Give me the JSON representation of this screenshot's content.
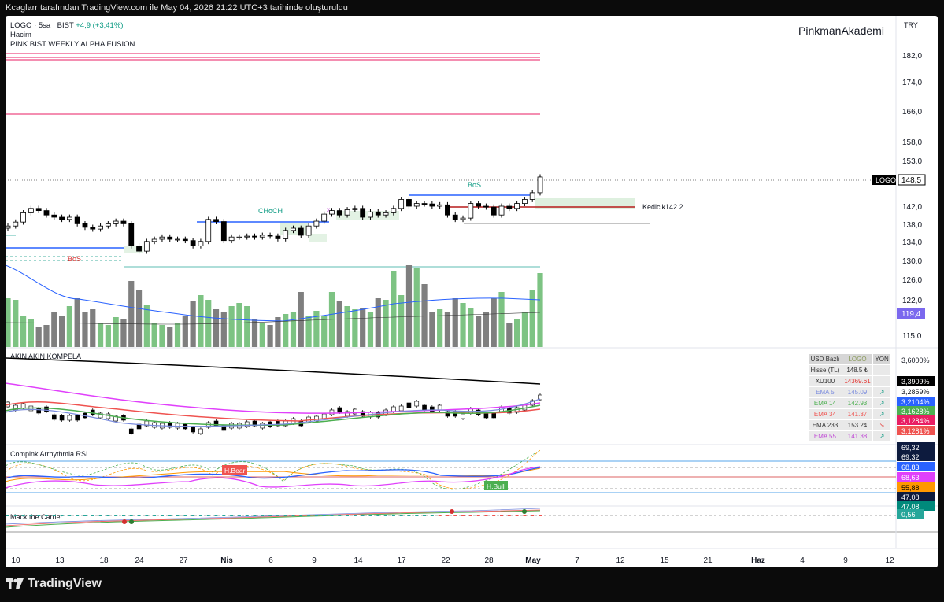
{
  "topbar": {
    "text": "Kcaglarr tarafından TradingView.com ile May 04, 2026 21:22 UTC+3 tarihinde oluşturuldu"
  },
  "legend": {
    "symbol": "LOGO · 5sa · BIST",
    "change": "+4,9 (+3,41%)",
    "volume": "Hacim",
    "indicator": "PINK BIST WEEKLY ALPHA FUSION"
  },
  "brand": "PinkmanAkademi",
  "currency": "TRY",
  "footer": {
    "logo_text": "TradingView"
  },
  "colors": {
    "up": "#ffffff",
    "down": "#000000",
    "vol_up": "#7dc383",
    "vol_down": "#7f7f7f",
    "pink": "#e91e63",
    "blue": "#2962ff",
    "green": "#089981",
    "red": "#d32f2f"
  },
  "chart_data": {
    "type": "candlestick",
    "price_axis": {
      "labels": [
        "182,0",
        "174,0",
        "166,0",
        "158,0",
        "153,0",
        "142,0",
        "138,0",
        "134,0",
        "130,0",
        "126,0",
        "122,0",
        "115,0"
      ],
      "last_price": "148,5",
      "last_label": "LOGO",
      "volume_value": "119,4"
    },
    "x_axis": {
      "labels": [
        "10",
        "13",
        "18",
        "24",
        "27",
        "Nis",
        "6",
        "9",
        "14",
        "17",
        "22",
        "28",
        "May",
        "7",
        "12",
        "15",
        "21",
        "Haz",
        "4",
        "9",
        "12"
      ]
    },
    "closes": [
      137.5,
      138.4,
      140.5,
      141.5,
      141,
      140,
      139.5,
      139,
      139.5,
      138,
      137.2,
      136.8,
      137.5,
      138,
      138.6,
      138,
      133,
      131.8,
      134,
      134.5,
      135,
      134.5,
      134.5,
      134.2,
      133,
      134,
      139,
      138.5,
      134.2,
      135,
      135,
      135.2,
      135,
      135.4,
      135.2,
      134.6,
      136.5,
      137,
      135.4,
      137.5,
      138.6,
      140.2,
      141,
      140,
      141.2,
      141.5,
      139.5,
      140.7,
      140,
      140.5,
      141.5,
      143.5,
      142,
      142.6,
      142.5,
      142,
      142.3,
      140,
      139,
      139.3,
      142.6,
      142,
      141.8,
      140,
      142,
      141.5,
      142.6,
      143.5,
      145,
      148.5
    ],
    "zones": {
      "bos_top": "BoS",
      "choch": "CHoCH",
      "bos_left": "BoS",
      "marker": "x",
      "kedicik": "Kedicik142.2"
    },
    "sub_pane1": {
      "title": "AKIN AKIN KOMPELA",
      "right_labels": [
        "3,6000%",
        "3,3909%",
        "3,2859%",
        "3,2104%",
        "3,1628%",
        "3,1284%",
        "3,1281%"
      ]
    },
    "sub_pane2": {
      "title": "Compink Arrhythmia RSI",
      "labels": [
        "H.Bear",
        "H.Bull"
      ],
      "right_labels": [
        "69,32",
        "69,32",
        "68,83",
        "68,63",
        "55,88",
        "47,08",
        "47,08"
      ]
    },
    "sub_pane3": {
      "title": "Mack the Carrier",
      "value": "0,56"
    }
  },
  "table": {
    "headers": [
      "USD Bazlı",
      "LOGO",
      "YÖN"
    ],
    "rows": [
      {
        "name": "Hisse (TL)",
        "value": "148.5 ₺",
        "dir": ""
      },
      {
        "name": "XU100",
        "value": "14369.61",
        "dir": ""
      },
      {
        "name": "EMA 5",
        "value": "145.09",
        "dir": "↗"
      },
      {
        "name": "EMA 14",
        "value": "142.93",
        "dir": "↗"
      },
      {
        "name": "EMA 34",
        "value": "141.37",
        "dir": "↗"
      },
      {
        "name": "EMA 233",
        "value": "153.24",
        "dir": "↘"
      },
      {
        "name": "EMA 55",
        "value": "141.38",
        "dir": "↗"
      }
    ]
  }
}
